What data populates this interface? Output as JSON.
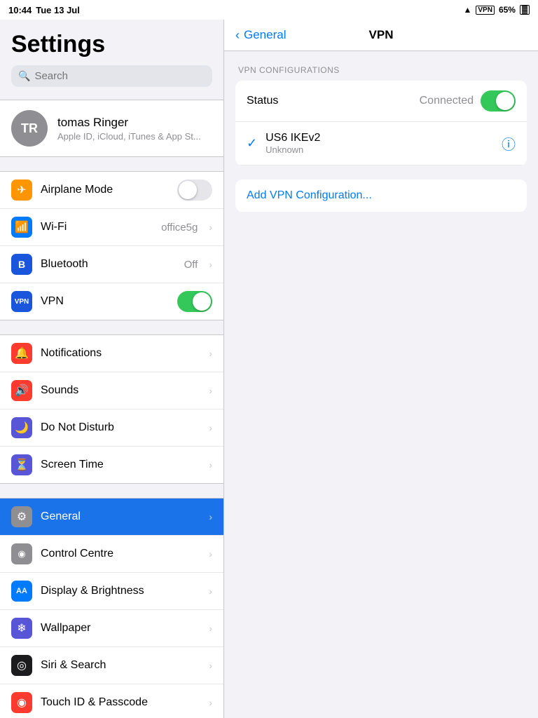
{
  "statusBar": {
    "time": "10:44",
    "date": "Tue 13 Jul",
    "wifi": "wifi",
    "vpn": "VPN",
    "battery": "65%"
  },
  "sidebar": {
    "title": "Settings",
    "search": {
      "placeholder": "Search"
    },
    "user": {
      "initials": "TR",
      "name": "tomas Ringer",
      "subtitle": "Apple ID, iCloud, iTunes & App St..."
    },
    "groups": [
      {
        "items": [
          {
            "id": "airplane",
            "label": "Airplane Mode",
            "icon": "✈",
            "bg": "bg-orange",
            "toggle": true,
            "toggleOn": false
          },
          {
            "id": "wifi",
            "label": "Wi-Fi",
            "icon": "📶",
            "bg": "bg-blue",
            "value": "office5g"
          },
          {
            "id": "bluetooth",
            "label": "Bluetooth",
            "icon": "🔷",
            "bg": "bg-blue-dark",
            "value": "Off"
          },
          {
            "id": "vpn",
            "label": "VPN",
            "icon": "VPN",
            "bg": "bg-vpn",
            "toggle": true,
            "toggleOn": true
          }
        ]
      },
      {
        "items": [
          {
            "id": "notifications",
            "label": "Notifications",
            "icon": "🔔",
            "bg": "bg-red-notification"
          },
          {
            "id": "sounds",
            "label": "Sounds",
            "icon": "🔊",
            "bg": "bg-red"
          },
          {
            "id": "donotdisturb",
            "label": "Do Not Disturb",
            "icon": "🌙",
            "bg": "bg-indigo"
          },
          {
            "id": "screentime",
            "label": "Screen Time",
            "icon": "⏳",
            "bg": "bg-purple"
          }
        ]
      },
      {
        "items": [
          {
            "id": "general",
            "label": "General",
            "icon": "⚙",
            "bg": "bg-gray",
            "active": true
          },
          {
            "id": "controlcentre",
            "label": "Control Centre",
            "icon": "◉",
            "bg": "bg-control"
          },
          {
            "id": "display",
            "label": "Display & Brightness",
            "icon": "AA",
            "bg": "bg-display"
          },
          {
            "id": "wallpaper",
            "label": "Wallpaper",
            "icon": "❄",
            "bg": "bg-wallpaper"
          },
          {
            "id": "siri",
            "label": "Siri & Search",
            "icon": "◎",
            "bg": "bg-siri"
          },
          {
            "id": "touchid",
            "label": "Touch ID & Passcode",
            "icon": "◉",
            "bg": "bg-touchid"
          }
        ]
      }
    ]
  },
  "vpnPanel": {
    "backLabel": "General",
    "title": "VPN",
    "sectionLabel": "VPN CONFIGURATIONS",
    "statusLabel": "Status",
    "statusValue": "Connected",
    "toggleOn": true,
    "vpnConfig": {
      "name": "US6 IKEv2",
      "sub": "Unknown"
    },
    "addButton": "Add VPN Configuration..."
  }
}
